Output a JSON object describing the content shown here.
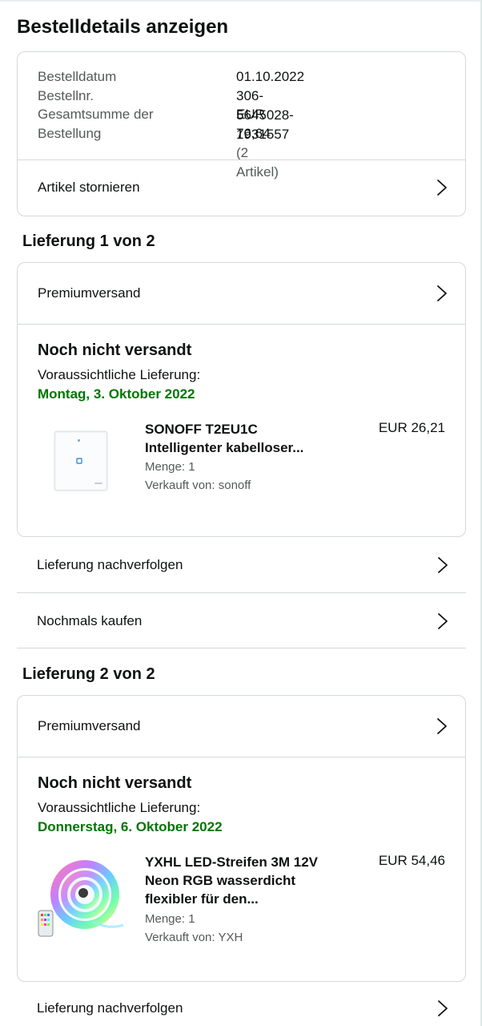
{
  "page": {
    "title": "Bestelldetails anzeigen"
  },
  "summary": {
    "order_date_label": "Bestelldatum",
    "order_date_value": "01.10.2022",
    "order_no_label": "Bestellnr.",
    "order_no_value": "306-5645028-1931557",
    "total_label_line1": "Gesamtsumme der",
    "total_label_line2": "Bestellung",
    "total_value": "EUR 76,64",
    "total_items": "(2 Artikel)",
    "cancel_label": "Artikel stornieren"
  },
  "shipments": [
    {
      "title": "Lieferung 1 von 2",
      "shipping_method": "Premiumversand",
      "status": "Noch nicht versandt",
      "expected_label": "Voraussichtliche Lieferung:",
      "expected_date": "Montag, 3. Oktober 2022",
      "product": {
        "title_line1": "SONOFF T2EU1C",
        "title_line2": "Intelligenter kabelloser...",
        "price": "EUR 26,21",
        "quantity": "Menge: 1",
        "seller": "Verkauft von: sonoff"
      },
      "track_label": "Lieferung nachverfolgen",
      "buy_again_label": "Nochmals kaufen"
    },
    {
      "title": "Lieferung 2 von 2",
      "shipping_method": "Premiumversand",
      "status": "Noch nicht versandt",
      "expected_label": "Voraussichtliche Lieferung:",
      "expected_date": "Donnerstag, 6. Oktober 2022",
      "product": {
        "title_line1": "YXHL LED-Streifen 3M 12V",
        "title_line2": "Neon RGB wasserdicht",
        "title_line3": "flexibler für den...",
        "price": "EUR 54,46",
        "quantity": "Menge: 1",
        "seller": "Verkauft von: YXH"
      },
      "track_label": "Lieferung nachverfolgen"
    }
  ],
  "icons": {
    "chevron": "chevron-right-icon"
  },
  "colors": {
    "delivery_green": "#007600",
    "text": "#0f1111",
    "muted": "#565959",
    "border": "#d5d9d9"
  }
}
